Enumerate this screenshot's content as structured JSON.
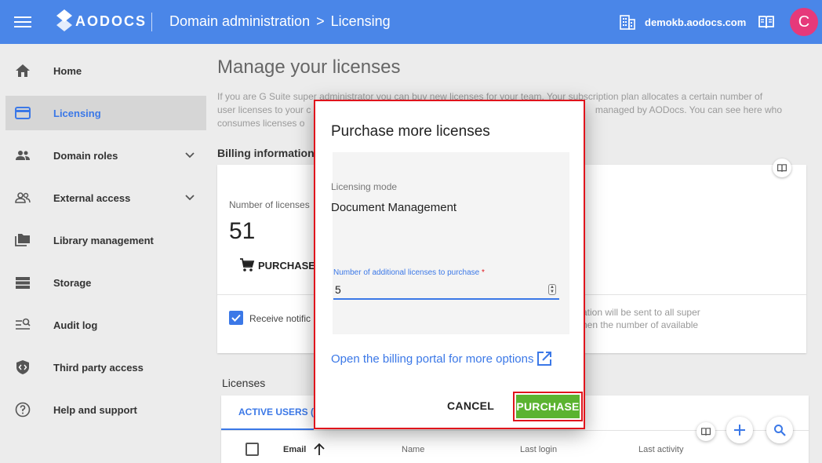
{
  "topbar": {
    "logo_text": "AODOCS",
    "breadcrumb_parent": "Domain administration",
    "breadcrumb_separator": ">",
    "breadcrumb_current": "Licensing",
    "domain": "demokb.aodocs.com",
    "avatar_letter": "C",
    "bar_color": "#4a86e8",
    "avatar_color": "#e6397a"
  },
  "sidebar": {
    "items": [
      {
        "label": "Home",
        "icon": "home-icon"
      },
      {
        "label": "Licensing",
        "icon": "card-icon",
        "active": true
      },
      {
        "label": "Domain roles",
        "icon": "people-icon",
        "expandable": true
      },
      {
        "label": "External access",
        "icon": "people-outline-icon",
        "expandable": true
      },
      {
        "label": "Library management",
        "icon": "folders-icon"
      },
      {
        "label": "Storage",
        "icon": "storage-icon"
      },
      {
        "label": "Audit log",
        "icon": "audit-icon"
      },
      {
        "label": "Third party access",
        "icon": "shield-code-icon"
      },
      {
        "label": "Help and support",
        "icon": "help-icon"
      }
    ]
  },
  "main": {
    "title": "Manage your licenses",
    "intro_line1": "If you are G Suite super administrator you can buy new licenses for your team. Your subscription plan allocates a certain number of",
    "intro_line2": "user licenses to your c",
    "intro_line2_end": "managed by AODocs. You can see here who",
    "intro_line3": "consumes licenses o",
    "billing_title": "Billing information",
    "number_of_licenses_label": "Number of licenses",
    "number_of_licenses": "51",
    "purchase_label": "PURCHASE",
    "receive_label": "Receive notific",
    "notif_line1": "ation will be sent to all super",
    "notif_line2": "hen the number of available",
    "licenses_title": "Licenses",
    "active_users_tab": "ACTIVE USERS (5",
    "columns": [
      "Email",
      "Name",
      "Last login",
      "Last activity"
    ]
  },
  "dialog": {
    "title": "Purchase more licenses",
    "mode_label": "Licensing mode",
    "mode_value": "Document Management",
    "input_label": "Number of additional licenses to purchase",
    "input_required": "*",
    "input_value": "5",
    "billing_link": "Open the billing portal for more options",
    "cancel_label": "CANCEL",
    "purchase_label": "PURCHASE",
    "purchase_color": "#5bb330",
    "highlight_color": "#e0141c"
  }
}
